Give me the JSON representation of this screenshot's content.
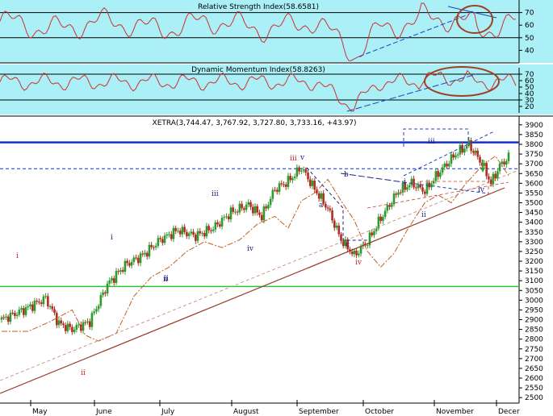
{
  "colors": {
    "panel_bg": "#aaf0f6",
    "chart_bg": "#ffffff",
    "osc_line": "#d03030",
    "up_candle": "#2e9a2e",
    "down_candle": "#b03020",
    "ma_line": "#c06020",
    "support_line": "#9a3a2a",
    "trend_blue": "#2040c0",
    "resistance": "#1530c8",
    "support_green": "#30c030",
    "ellipse": "#a04020",
    "wave_red": "#cc2020",
    "wave_navy": "#202080"
  },
  "chart_data": [
    {
      "type": "line",
      "title": "Relative Strength Index(58.6581)",
      "ylim": [
        30,
        80
      ],
      "yticks": [
        "40",
        "50",
        "60",
        "70"
      ],
      "reference_lines": [
        70,
        50,
        30
      ],
      "grid": false,
      "annotations": [
        "dashed rising trendline",
        "descending trendline",
        "circle highlighting divergence"
      ]
    },
    {
      "type": "line",
      "title": "Dynamic Momentum Index(58.8263)",
      "ylim": [
        10,
        80
      ],
      "yticks": [
        "20",
        "30",
        "40",
        "50",
        "60",
        "70"
      ],
      "reference_lines": [
        70,
        30
      ],
      "grid": false,
      "annotations": [
        "dashed rising trendline",
        "ellipse highlighting divergence"
      ]
    },
    {
      "type": "candlestick",
      "title": "XETRA(3,744.47, 3,767.92, 3,727.80, 3,733.16, +43.97)",
      "ylim": [
        2480,
        3920
      ],
      "yticks": [
        "2500",
        "2550",
        "2600",
        "2650",
        "2700",
        "2750",
        "2800",
        "2850",
        "2900",
        "2950",
        "3000",
        "3050",
        "3100",
        "3150",
        "3200",
        "3250",
        "3300",
        "3350",
        "3400",
        "3450",
        "3500",
        "3550",
        "3600",
        "3650",
        "3700",
        "3750",
        "3800",
        "3850",
        "3900"
      ],
      "x_months": [
        "May",
        "June",
        "July",
        "August",
        "September",
        "October",
        "November",
        "Decer"
      ],
      "horizontal_levels": [
        3810,
        3675,
        3070
      ],
      "series": [
        {
          "name": "",
          "kind": "ohlc",
          "approx_path": [
            [
              0,
              2900
            ],
            [
              10,
              2950
            ],
            [
              20,
              3010
            ],
            [
              26,
              2880
            ],
            [
              32,
              2850
            ],
            [
              40,
              2890
            ],
            [
              48,
              3080
            ],
            [
              56,
              3180
            ],
            [
              64,
              3230
            ],
            [
              72,
              3310
            ],
            [
              80,
              3360
            ],
            [
              88,
              3330
            ],
            [
              96,
              3370
            ],
            [
              104,
              3450
            ],
            [
              112,
              3490
            ],
            [
              118,
              3430
            ],
            [
              124,
              3570
            ],
            [
              130,
              3610
            ],
            [
              136,
              3680
            ],
            [
              142,
              3570
            ],
            [
              148,
              3470
            ],
            [
              154,
              3310
            ],
            [
              160,
              3230
            ],
            [
              166,
              3300
            ],
            [
              172,
              3420
            ],
            [
              180,
              3560
            ],
            [
              186,
              3600
            ],
            [
              192,
              3560
            ],
            [
              198,
              3650
            ],
            [
              206,
              3750
            ],
            [
              212,
              3800
            ],
            [
              218,
              3700
            ],
            [
              222,
              3600
            ],
            [
              226,
              3690
            ],
            [
              230,
              3733
            ]
          ]
        }
      ],
      "wave_labels": [
        "i",
        "ii",
        "i",
        "ii",
        "iii",
        "iv",
        "v",
        "a",
        "b",
        "c",
        "iii",
        "iv",
        "iii",
        "ii",
        "v",
        "iv",
        "i",
        "ii"
      ]
    }
  ]
}
